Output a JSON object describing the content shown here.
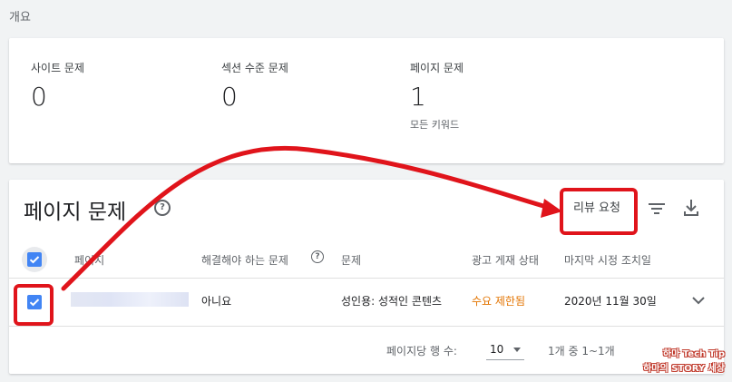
{
  "overview": {
    "title": "개요"
  },
  "summary": {
    "site_label": "사이트 문제",
    "site_value": "0",
    "section_label": "섹션 수준 문제",
    "section_value": "0",
    "page_label": "페이지 문제",
    "page_value": "1",
    "page_sub": "모든 키워드"
  },
  "table": {
    "title": "페이지 문제",
    "review_label": "리뷰 요청",
    "headers": {
      "page": "페이지",
      "resolve": "해결해야 하는 문제",
      "issue": "문제",
      "ad_status": "광고 게재 상태",
      "last_action": "마지막 시정 조치일"
    },
    "rows": [
      {
        "resolve": "아니요",
        "issue": "성인용: 성적인 콘텐츠",
        "ad_status": "수요 제한됨",
        "last_action": "2020년 11월 30일"
      }
    ],
    "pagination": {
      "rows_label": "페이지당 행 수:",
      "rows_value": "10",
      "range": "1개 중 1~1개"
    }
  },
  "colors": {
    "accent": "#4285f4",
    "annotation": "#e0141b",
    "warning": "#e37400"
  },
  "watermark": {
    "line1": "하마 Tech Tip",
    "line2": "하마의 STORY 세상"
  }
}
